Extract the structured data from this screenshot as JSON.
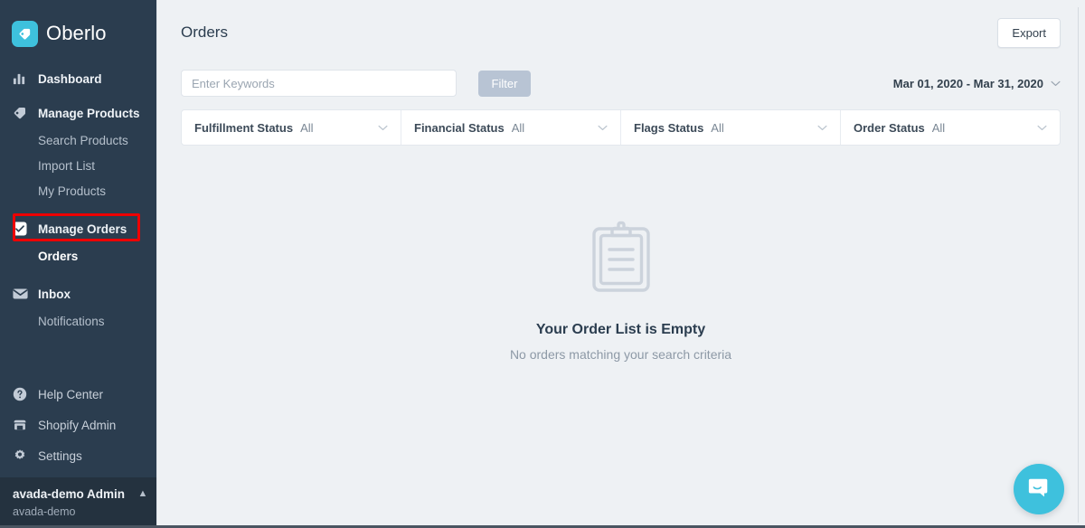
{
  "brand": {
    "name": "Oberlo",
    "logo_icon": "tag-icon",
    "accent_color": "#3ec1dd",
    "sidebar_color": "#2b3d4f"
  },
  "sidebar": {
    "items": [
      {
        "label": "Dashboard",
        "icon": "bar-chart-icon",
        "level": "primary"
      },
      {
        "label": "Manage Products",
        "icon": "tag-icon",
        "level": "primary"
      },
      {
        "label": "Search Products",
        "icon": "",
        "level": "sub"
      },
      {
        "label": "Import List",
        "icon": "",
        "level": "sub"
      },
      {
        "label": "My Products",
        "icon": "",
        "level": "sub"
      },
      {
        "label": "Manage Orders",
        "icon": "check-square-icon",
        "level": "primary"
      },
      {
        "label": "Orders",
        "icon": "",
        "level": "sub",
        "active": true,
        "highlighted": true
      },
      {
        "label": "Inbox",
        "icon": "envelope-icon",
        "level": "primary"
      },
      {
        "label": "Notifications",
        "icon": "",
        "level": "sub"
      }
    ],
    "bottom_items": [
      {
        "label": "Help Center",
        "icon": "question-circle-icon"
      },
      {
        "label": "Shopify Admin",
        "icon": "store-icon"
      },
      {
        "label": "Settings",
        "icon": "gear-icon"
      }
    ],
    "user": {
      "name": "avada-demo Admin",
      "shop": "avada-demo",
      "caret_icon": "chevron-up-icon"
    }
  },
  "header": {
    "title": "Orders",
    "export_label": "Export"
  },
  "search": {
    "placeholder": "Enter Keywords",
    "value": "",
    "filter_label": "Filter",
    "date_range": "Mar 01, 2020 - Mar 31, 2020",
    "date_caret_icon": "chevron-down-icon"
  },
  "filters": [
    {
      "label": "Fulfillment Status",
      "value": "All",
      "caret_icon": "chevron-down-icon"
    },
    {
      "label": "Financial Status",
      "value": "All",
      "caret_icon": "chevron-down-icon"
    },
    {
      "label": "Flags Status",
      "value": "All",
      "caret_icon": "chevron-down-icon"
    },
    {
      "label": "Order Status",
      "value": "All",
      "caret_icon": "chevron-down-icon"
    }
  ],
  "empty_state": {
    "icon": "clipboard-icon",
    "title": "Your Order List is Empty",
    "subtitle": "No orders matching your search criteria"
  },
  "chat": {
    "icon": "chat-bubble-icon",
    "color": "#3ec1dd"
  },
  "annotation": {
    "type": "red-highlight-rectangle",
    "target": "Orders",
    "color": "#ee0000"
  }
}
